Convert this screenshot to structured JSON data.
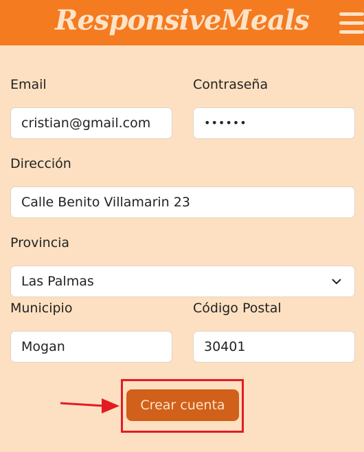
{
  "header": {
    "logo": "ResponsiveMeals",
    "menu_icon": "hamburger-menu-icon"
  },
  "form": {
    "email_label": "Email",
    "email_value": "cristian@gmail.com",
    "password_label": "Contraseña",
    "password_value": "••••••",
    "address_label": "Dirección",
    "address_value": "Calle Benito Villamarin 23",
    "province_label": "Provincia",
    "province_value": "Las Palmas",
    "municipality_label": "Municipio",
    "municipality_value": "Mogan",
    "postal_label": "Código Postal",
    "postal_value": "30401",
    "submit_label": "Crear cuenta"
  },
  "colors": {
    "header": "#f47b20",
    "background": "#fde0c1",
    "button": "#d0601a",
    "annotation": "#e31b23"
  }
}
